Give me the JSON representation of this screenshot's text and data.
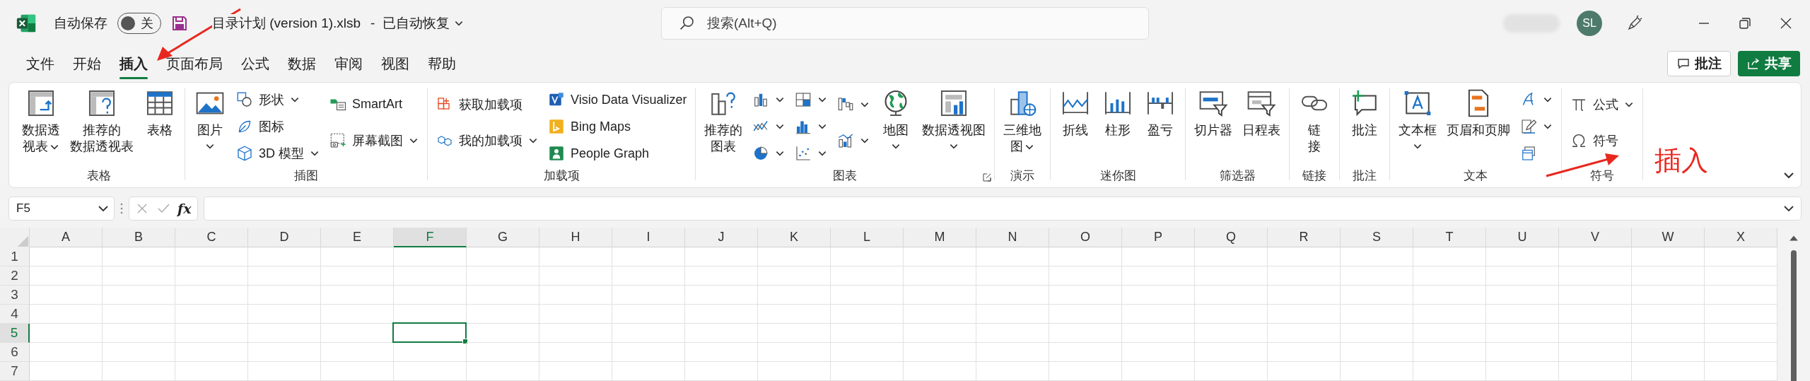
{
  "title_bar": {
    "autosave_label": "自动保存",
    "autosave": {
      "on": false,
      "label": "关"
    },
    "file_name": "目录计划 (version 1).xlsb",
    "status": "-  已自动恢复",
    "search": {
      "placeholder": "搜索(Alt+Q)"
    },
    "user_initials": "SL"
  },
  "tabs": [
    {
      "label": "文件",
      "selected": false
    },
    {
      "label": "开始",
      "selected": false
    },
    {
      "label": "插入",
      "selected": true
    },
    {
      "label": "页面布局",
      "selected": false
    },
    {
      "label": "公式",
      "selected": false
    },
    {
      "label": "数据",
      "selected": false
    },
    {
      "label": "审阅",
      "selected": false
    },
    {
      "label": "视图",
      "selected": false
    },
    {
      "label": "帮助",
      "selected": false
    }
  ],
  "header_buttons": [
    {
      "kind": "comments",
      "label": "批注"
    },
    {
      "kind": "share",
      "label": "共享"
    }
  ],
  "ribbon_groups": [
    {
      "label": "表格",
      "columns": [
        {
          "kind": "large",
          "lines": [
            "数据透",
            "视表"
          ],
          "dropdown": true
        },
        {
          "kind": "large",
          "lines": [
            "推荐的",
            "数据透视表"
          ],
          "dropdown": false
        },
        {
          "kind": "large",
          "lines": [
            "表格"
          ],
          "dropdown": false
        }
      ]
    },
    {
      "label": "插图",
      "columns": [
        {
          "kind": "large",
          "lines": [
            "图片"
          ],
          "dropdown": true
        },
        {
          "kind": "stack",
          "items": [
            {
              "label": "形状",
              "dropdown": true
            },
            {
              "label": "图标",
              "dropdown": false
            },
            {
              "label": "3D 模型",
              "dropdown": true
            }
          ]
        },
        {
          "kind": "stack",
          "items": [
            {
              "label": "SmartArt",
              "dropdown": false
            },
            {
              "label": "屏幕截图",
              "dropdown": true
            }
          ]
        }
      ]
    },
    {
      "label": "加载项",
      "columns": [
        {
          "kind": "stack",
          "items": [
            {
              "label": "获取加载项",
              "dropdown": false
            },
            {
              "label": "我的加载项",
              "dropdown": true
            }
          ]
        },
        {
          "kind": "stack",
          "items": [
            {
              "label": "Visio Data Visualizer",
              "dropdown": false
            },
            {
              "label": "Bing Maps",
              "dropdown": false
            },
            {
              "label": "People Graph",
              "dropdown": false
            }
          ]
        }
      ]
    },
    {
      "label": "图表",
      "launcher": true,
      "columns": [
        {
          "kind": "large",
          "lines": [
            "推荐的",
            "图表"
          ],
          "dropdown": false
        },
        {
          "kind": "stack",
          "items": [
            {
              "dropdown": true
            },
            {
              "dropdown": true
            },
            {
              "dropdown": true
            }
          ]
        },
        {
          "kind": "stack",
          "items": [
            {
              "dropdown": true
            },
            {
              "dropdown": true
            },
            {
              "dropdown": true
            }
          ]
        },
        {
          "kind": "stack",
          "items": [
            {
              "dropdown": true
            },
            {
              "dropdown": true
            }
          ]
        },
        {
          "kind": "large",
          "lines": [
            "地图"
          ],
          "dropdown": true
        },
        {
          "kind": "large",
          "lines": [
            "数据透视图"
          ],
          "dropdown": true
        }
      ]
    },
    {
      "label": "演示",
      "columns": [
        {
          "kind": "large",
          "lines": [
            "三维地",
            "图"
          ],
          "dropdown": true
        }
      ]
    },
    {
      "label": "迷你图",
      "columns": [
        {
          "kind": "large",
          "lines": [
            "折线"
          ],
          "dropdown": false
        },
        {
          "kind": "large",
          "lines": [
            "柱形"
          ],
          "dropdown": false
        },
        {
          "kind": "large",
          "lines": [
            "盈亏"
          ],
          "dropdown": false
        }
      ]
    },
    {
      "label": "筛选器",
      "columns": [
        {
          "kind": "large",
          "lines": [
            "切片器"
          ],
          "dropdown": false
        },
        {
          "kind": "large",
          "lines": [
            "日程表"
          ],
          "dropdown": false
        }
      ]
    },
    {
      "label": "链接",
      "columns": [
        {
          "kind": "large",
          "lines": [
            "链",
            "接"
          ],
          "dropdown": false
        }
      ]
    },
    {
      "label": "批注",
      "columns": [
        {
          "kind": "large",
          "lines": [
            "批注"
          ],
          "dropdown": false
        }
      ]
    },
    {
      "label": "文本",
      "columns": [
        {
          "kind": "large",
          "lines": [
            "文本框"
          ],
          "dropdown": true
        },
        {
          "kind": "large",
          "lines": [
            "页眉和页脚"
          ],
          "dropdown": false
        },
        {
          "kind": "stack",
          "items": [
            {
              "dropdown": true
            },
            {
              "dropdown": true
            },
            {
              "dropdown": false
            }
          ]
        }
      ]
    },
    {
      "label": "符号",
      "columns": [
        {
          "kind": "stack",
          "items": [
            {
              "label": "公式",
              "dropdown": true
            },
            {
              "label": "符号",
              "dropdown": false
            }
          ]
        }
      ]
    }
  ],
  "formula_bar": {
    "name_box": "F5",
    "function_label": "fx"
  },
  "columns": [
    {
      "label": "A",
      "selected": false
    },
    {
      "label": "B",
      "selected": false
    },
    {
      "label": "C",
      "selected": false
    },
    {
      "label": "D",
      "selected": false
    },
    {
      "label": "E",
      "selected": false
    },
    {
      "label": "F",
      "selected": true
    },
    {
      "label": "G",
      "selected": false
    },
    {
      "label": "H",
      "selected": false
    },
    {
      "label": "I",
      "selected": false
    },
    {
      "label": "J",
      "selected": false
    },
    {
      "label": "K",
      "selected": false
    },
    {
      "label": "L",
      "selected": false
    },
    {
      "label": "M",
      "selected": false
    },
    {
      "label": "N",
      "selected": false
    },
    {
      "label": "O",
      "selected": false
    },
    {
      "label": "P",
      "selected": false
    },
    {
      "label": "Q",
      "selected": false
    },
    {
      "label": "R",
      "selected": false
    },
    {
      "label": "S",
      "selected": false
    },
    {
      "label": "T",
      "selected": false
    },
    {
      "label": "U",
      "selected": false
    },
    {
      "label": "V",
      "selected": false
    },
    {
      "label": "W",
      "selected": false
    },
    {
      "label": "X",
      "selected": false
    }
  ],
  "rows": [
    {
      "label": "1",
      "selected": false
    },
    {
      "label": "2",
      "selected": false
    },
    {
      "label": "3",
      "selected": false
    },
    {
      "label": "4",
      "selected": false
    },
    {
      "label": "5",
      "selected": true
    },
    {
      "label": "6",
      "selected": false
    },
    {
      "label": "7",
      "selected": false
    }
  ],
  "annotations": [
    {
      "kind": "arrow"
    },
    {
      "kind": "arrow"
    },
    {
      "kind": "label",
      "text": "插入"
    }
  ]
}
